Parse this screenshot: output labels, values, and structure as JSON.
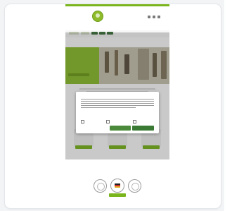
{
  "colors": {
    "brand_green": "#7ab51d",
    "hero_green": "#8bbd2b",
    "dialog_button_green": "#4a8a3a"
  },
  "header": {
    "logo_label": "",
    "icons": [
      "search-icon",
      "user-icon",
      "cart-icon"
    ],
    "cart_count": ""
  },
  "nav": {
    "items": [
      "",
      "",
      "",
      "",
      "",
      ""
    ]
  },
  "hero": {
    "title": "",
    "subtitle": ""
  },
  "cookie_dialog": {
    "title": "",
    "options_label": "",
    "options": [
      "",
      "",
      ""
    ],
    "link_label": "",
    "buttons": [
      "",
      ""
    ]
  },
  "bottom": {
    "title": "",
    "subtitle": ""
  }
}
